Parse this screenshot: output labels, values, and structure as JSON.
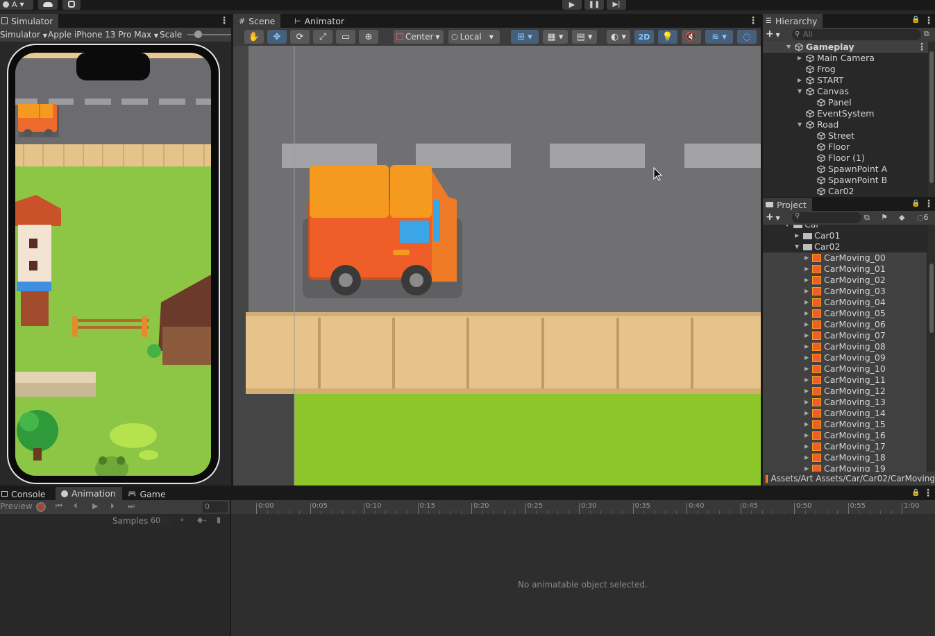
{
  "top_bar": {
    "account_label": "A",
    "play_icon": "play-icon",
    "pause_icon": "pause-icon",
    "step_icon": "step-icon"
  },
  "simulator": {
    "tab_label": "Simulator",
    "mode_dropdown": "Simulator",
    "device_dropdown": "Apple iPhone 13 Pro Max",
    "scale_label": "Scale"
  },
  "scene": {
    "tabs": [
      {
        "label": "Scene",
        "icon": "grid-icon"
      },
      {
        "label": "Animator",
        "icon": "animator-icon"
      }
    ],
    "pivot_dropdown": "Center",
    "space_dropdown": "Local",
    "mode_2d": "2D"
  },
  "hierarchy": {
    "tab_label": "Hierarchy",
    "search_placeholder": "All",
    "items": [
      {
        "label": "Gameplay",
        "depth": 0,
        "expanded": true,
        "bold": true
      },
      {
        "label": "Main Camera",
        "depth": 1,
        "has_children": true
      },
      {
        "label": "Frog",
        "depth": 1
      },
      {
        "label": "START",
        "depth": 1,
        "has_children": true
      },
      {
        "label": "Canvas",
        "depth": 1,
        "expanded": true
      },
      {
        "label": "Panel",
        "depth": 2
      },
      {
        "label": "EventSystem",
        "depth": 1
      },
      {
        "label": "Road",
        "depth": 1,
        "expanded": true
      },
      {
        "label": "Street",
        "depth": 2
      },
      {
        "label": "Floor",
        "depth": 2
      },
      {
        "label": "Floor (1)",
        "depth": 2
      },
      {
        "label": "SpawnPoint A",
        "depth": 2
      },
      {
        "label": "SpawnPoint B",
        "depth": 2
      },
      {
        "label": "Car02",
        "depth": 2
      }
    ]
  },
  "project": {
    "tab_label": "Project",
    "hidden_count": "6",
    "partial_row": "Car",
    "folders": [
      {
        "label": "Car01",
        "expanded": false
      },
      {
        "label": "Car02",
        "expanded": true
      }
    ],
    "sprites": [
      "CarMoving_00",
      "CarMoving_01",
      "CarMoving_02",
      "CarMoving_03",
      "CarMoving_04",
      "CarMoving_05",
      "CarMoving_06",
      "CarMoving_07",
      "CarMoving_08",
      "CarMoving_09",
      "CarMoving_10",
      "CarMoving_11",
      "CarMoving_12",
      "CarMoving_13",
      "CarMoving_14",
      "CarMoving_15",
      "CarMoving_16",
      "CarMoving_17",
      "CarMoving_18",
      "CarMoving_19"
    ],
    "path": "Assets/Art Assets/Car/Car02/CarMoving"
  },
  "bottom": {
    "tabs": [
      {
        "label": "Console",
        "icon": "console-icon"
      },
      {
        "label": "Animation",
        "icon": "clock-icon"
      },
      {
        "label": "Game",
        "icon": "gamepad-icon"
      }
    ],
    "preview_label": "Preview",
    "frame_value": "0",
    "samples_label": "Samples",
    "samples_value": "60",
    "timeline_ticks": [
      "0:00",
      "0:05",
      "0:10",
      "0:15",
      "0:20",
      "0:25",
      "0:30",
      "0:35",
      "0:40",
      "0:45",
      "0:50",
      "0:55",
      "1:00"
    ],
    "empty_message": "No animatable object selected."
  },
  "colors": {
    "accent": "#3a72b0",
    "selection": "#2c5d87"
  }
}
